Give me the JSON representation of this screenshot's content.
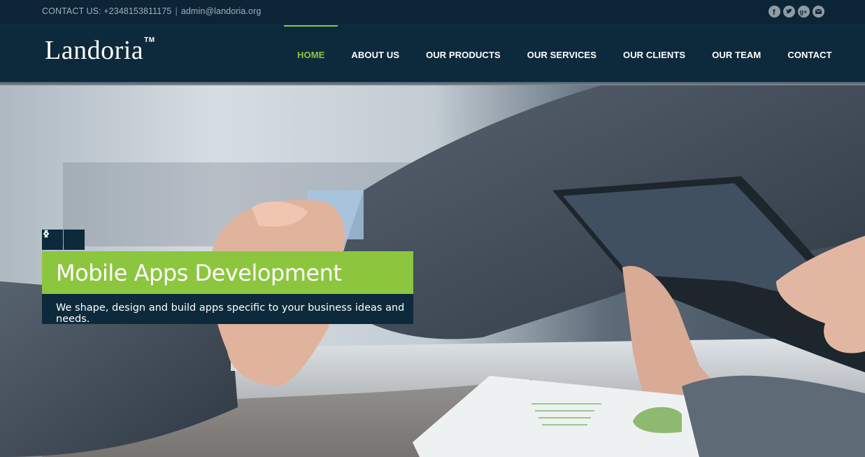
{
  "topbar": {
    "contact_label": "CONTACT US: +2348153811175",
    "separator": "|",
    "email": "admin@landoria.org",
    "social": [
      "facebook-icon",
      "twitter-icon",
      "google-plus-icon",
      "email-icon"
    ]
  },
  "header": {
    "logo": "Landoria",
    "logo_tm": "TM",
    "nav": [
      {
        "label": "HOME",
        "active": true
      },
      {
        "label": "ABOUT US"
      },
      {
        "label": "OUR PRODUCTS"
      },
      {
        "label": "OUR SERVICES"
      },
      {
        "label": "OUR CLIENTS"
      },
      {
        "label": "OUR TEAM"
      },
      {
        "label": "CONTACT"
      }
    ]
  },
  "hero": {
    "slide_title": "Mobile Apps Development",
    "slide_text": "We shape, design and build apps specific to your business ideas and needs.",
    "prev_icon": "chevron-left-icon",
    "next_icon": "chevron-right-icon"
  },
  "colors": {
    "accent": "#8cc63f",
    "navy": "#0d2a3c",
    "topbar": "#0b2537"
  }
}
